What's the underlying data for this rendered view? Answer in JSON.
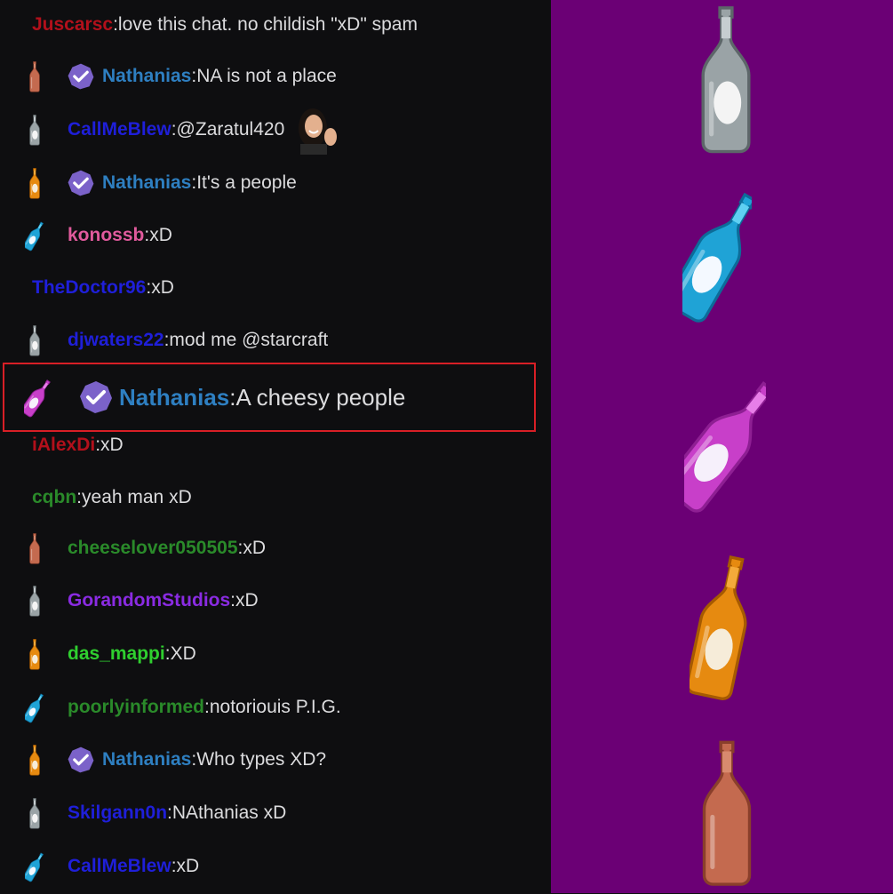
{
  "colors": {
    "chat_bg": "#0e0e10",
    "sidebar_bg": "#6b0075",
    "highlight_border": "#d81f26",
    "text": "#dcdcde"
  },
  "messages": [
    {
      "user": "Juscarsc",
      "color": "#b2101b",
      "text": "love this chat. no childish \"xD\" spam",
      "bottle": "none",
      "badge": false
    },
    {
      "user": "Nathanias",
      "color": "#2e7fc1",
      "text": "NA is not a place",
      "bottle": "brown-bottle-icon",
      "badge": true
    },
    {
      "user": "CallMeBlew",
      "color": "#1f1fd9",
      "text": "@Zaratul420",
      "bottle": "silver-bottle-icon",
      "badge": false,
      "emote": "waving-woman-emote"
    },
    {
      "user": "Nathanias",
      "color": "#2e7fc1",
      "text": "It's a people",
      "bottle": "orange-bottle-icon",
      "badge": true
    },
    {
      "user": "konossb",
      "color": "#e05a9c",
      "text": "xD",
      "bottle": "blue-bottle-icon",
      "badge": false
    },
    {
      "user": "TheDoctor96",
      "color": "#1f1fd9",
      "text": "xD",
      "bottle": "none",
      "badge": false
    },
    {
      "user": "djwaters22",
      "color": "#1f1fd9",
      "text": "mod me @starcraft",
      "bottle": "silver-bottle-icon",
      "badge": false
    },
    {
      "user": "Nathanias",
      "color": "#2e7fc1",
      "text": "A cheesy people",
      "bottle": "pink-bottle-icon",
      "badge": true,
      "highlight": true
    },
    {
      "user": "iAlexDi",
      "color": "#b2101b",
      "text": "xD",
      "bottle": "none",
      "badge": false
    },
    {
      "user": "cqbn",
      "color": "#2a8a2a",
      "text": "yeah man xD",
      "bottle": "none",
      "badge": false
    },
    {
      "user": "cheeselover050505",
      "color": "#2a8a2a",
      "text": "xD",
      "bottle": "brown-bottle-icon",
      "badge": false
    },
    {
      "user": "GorandomStudios",
      "color": "#8a2be2",
      "text": "xD",
      "bottle": "silver-bottle-icon",
      "badge": false
    },
    {
      "user": "das_mappi",
      "color": "#2fcf2f",
      "text": "XD",
      "bottle": "orange-bottle-icon",
      "badge": false
    },
    {
      "user": "poorlyinformed",
      "color": "#2a8a2a",
      "text": "notoriouis P.I.G.",
      "bottle": "blue-bottle-icon",
      "badge": false
    },
    {
      "user": "Nathanias",
      "color": "#2e7fc1",
      "text": "Who types XD?",
      "bottle": "orange-bottle-icon",
      "badge": true
    },
    {
      "user": "Skilgann0n",
      "color": "#1f1fd9",
      "text": "NAthanias xD",
      "bottle": "silver-bottle-icon",
      "badge": false
    },
    {
      "user": "CallMeBlew",
      "color": "#1f1fd9",
      "text": "xD",
      "bottle": "blue-bottle-icon",
      "badge": false
    }
  ],
  "sidebar": {
    "bottles": [
      "silver-bottle-icon",
      "blue-bottle-icon",
      "pink-bottle-icon",
      "orange-bottle-icon",
      "brown-bottle-icon"
    ]
  }
}
